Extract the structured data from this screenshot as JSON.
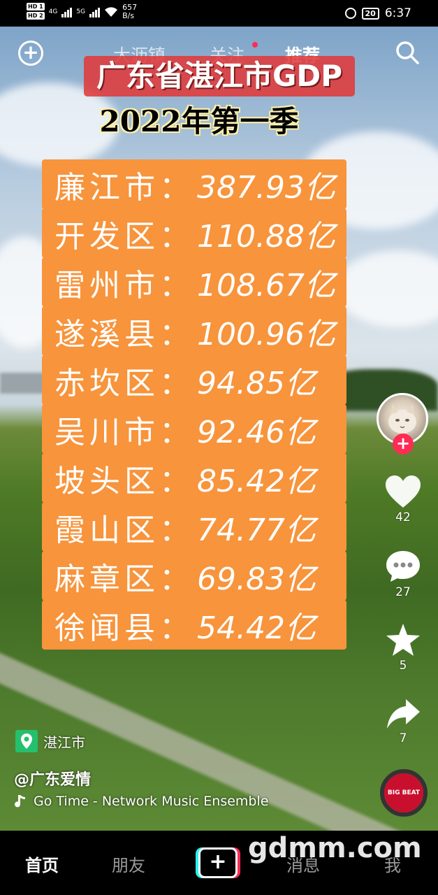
{
  "status_bar": {
    "sim1": "HD 1",
    "sim2": "HD 2",
    "net1": "4G",
    "net2": "5G",
    "speed": "657",
    "speed_unit": "B/s",
    "battery": "20",
    "time": "6:37"
  },
  "top_nav": {
    "tabs": [
      "大沥镇",
      "关注",
      "推荐"
    ],
    "active_tab": "推荐",
    "follow_has_dot": true
  },
  "video": {
    "title": "广东省湛江市GDP",
    "subtitle": "2022年第一季",
    "rows": [
      {
        "name": "廉江市：",
        "value": "387.93亿"
      },
      {
        "name": "开发区：",
        "value": "110.88亿"
      },
      {
        "name": "雷州市：",
        "value": "108.67亿"
      },
      {
        "name": "遂溪县：",
        "value": "100.96亿"
      },
      {
        "name": "赤坎区：",
        "value": "94.85亿"
      },
      {
        "name": "吴川市：",
        "value": "92.46亿"
      },
      {
        "name": "坡头区：",
        "value": "85.42亿"
      },
      {
        "name": "霞山区：",
        "value": "74.77亿"
      },
      {
        "name": "麻章区：",
        "value": "69.83亿"
      },
      {
        "name": "徐闻县：",
        "value": "54.42亿"
      }
    ]
  },
  "rail": {
    "likes": "42",
    "comments": "27",
    "favorites": "5",
    "shares": "7"
  },
  "info": {
    "location": "湛江市",
    "author": "@广东爱情",
    "music": "Go Time - Network Music Ensemble",
    "disc_label": "BIG BEAT"
  },
  "bottom_nav": {
    "home": "首页",
    "friends": "朋友",
    "create": "+",
    "messages": "消息",
    "me": "我"
  },
  "watermark": "gdmm.com",
  "colors": {
    "accent_red": "#fe2c55",
    "accent_cyan": "#25f4ee",
    "row_orange": "#f7943c",
    "banner_red": "#e23636",
    "location_green": "#25c06e"
  }
}
